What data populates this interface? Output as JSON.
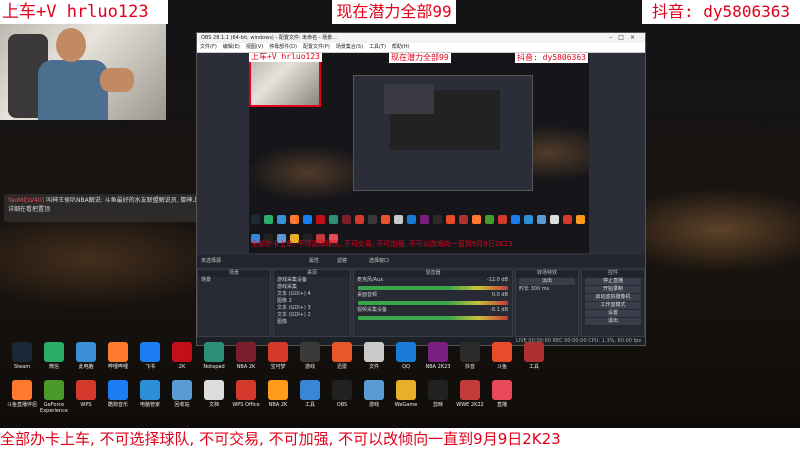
{
  "overlay": {
    "top_left": "上车+V hrluo123",
    "top_center": "现在潜力全部99",
    "top_right": "抖音: dy5806363",
    "bottom": "全部办卡上车, 不可选择球队, 不可交易, 不可加强, 不可以改倾向一直到9月9日2K23"
  },
  "chat": {
    "user": "YaoMi[LV40]",
    "message": "叫神王侯叭NBA解说: 斗鱼最好的水友联盟解说员, 御神上车规则详细在看把置顶"
  },
  "obs": {
    "title": "OBS 28.1.1 (64-bit, windows) - 配置文件: 未命名 - 场景...",
    "menu": [
      "文件(F)",
      "编辑(E)",
      "视图(V)",
      "停靠部件(D)",
      "配置文件(P)",
      "场景集合(S)",
      "工具(T)",
      "帮助(H)"
    ],
    "preview": {
      "banner_left": "上车+V hrluo123",
      "banner_center": "现在潜力全部99",
      "banner_right": "抖音: dy5806363",
      "bottom_text": "全部办卡上车, 不可选择球队, 不可交易, 不可加强, 不可以改倾向一直到9月9日2K23"
    },
    "ctrlbar": {
      "source": "未选择源",
      "properties": "属性",
      "filters": "滤镜",
      "capture": "选择窗口"
    },
    "docks": {
      "scenes": {
        "title": "场景",
        "items": [
          "场景"
        ]
      },
      "sources": {
        "title": "来源",
        "items": [
          "游戏采集设备",
          "游戏采集",
          "文本 (GDI+) 4",
          "图像 2",
          "文本 (GDI+) 3",
          "文本 (GDI+) 2",
          "图像"
        ]
      },
      "mixer": {
        "title": "混音器",
        "channels": [
          {
            "name": "麦克风/Aux",
            "db": "-12.0 dB"
          },
          {
            "name": "桌面音频",
            "db": "0.0 dB"
          },
          {
            "name": "视频采集设备",
            "db": "-8.1 dB"
          }
        ]
      },
      "transitions": {
        "title": "转场特效",
        "type": "淡出",
        "duration_label": "时长",
        "duration": "300 ms"
      },
      "controls": {
        "title": "控件",
        "buttons": [
          "停止直播",
          "开始录制",
          "启动虚拟摄像机",
          "工作室模式",
          "设置",
          "退出"
        ]
      }
    },
    "statusbar": "LIVE 00:00:00  REC 00:00:00  CPU: 1.3%, 60.00 fps"
  },
  "desktop": {
    "row1": [
      {
        "label": "Steam",
        "color": "#1b2838"
      },
      {
        "label": "微信",
        "color": "#2aae67"
      },
      {
        "label": "此电脑",
        "color": "#3a8fd6"
      },
      {
        "label": "哔哩哔哩",
        "color": "#ff7a2f"
      },
      {
        "label": "飞书",
        "color": "#1c7cf2"
      },
      {
        "label": "2K",
        "color": "#c40f1a"
      },
      {
        "label": "Notepad",
        "color": "#2f8f76"
      },
      {
        "label": "NBA 2K",
        "color": "#7a1f2b"
      },
      {
        "label": "宝可梦",
        "color": "#d33a2c"
      },
      {
        "label": "游戏",
        "color": "#3a3a3a"
      },
      {
        "label": "迅雷",
        "color": "#e8562c"
      },
      {
        "label": "文件",
        "color": "#c9c9c9"
      },
      {
        "label": "QQ",
        "color": "#1a7ad8"
      },
      {
        "label": "NBA 2K23",
        "color": "#7a1f7f"
      },
      {
        "label": "抖音",
        "color": "#2b2b2b"
      },
      {
        "label": "斗鱼",
        "color": "#e84a2a"
      },
      {
        "label": "工具",
        "color": "#b03030"
      }
    ],
    "row2": [
      {
        "label": "斗鱼直播伴侣",
        "color": "#ff7a2f"
      },
      {
        "label": "GeForce Experience",
        "color": "#4a9a2a"
      },
      {
        "label": "WPS",
        "color": "#d33a2c"
      },
      {
        "label": "酷狗音乐",
        "color": "#1c7cf2"
      },
      {
        "label": "电脑管家",
        "color": "#2a8fd6"
      },
      {
        "label": "回收站",
        "color": "#5b9bd5"
      },
      {
        "label": "文档",
        "color": "#ddd"
      },
      {
        "label": "WPS Office",
        "color": "#d33a2c"
      },
      {
        "label": "NBA 2K",
        "color": "#ff9a1a"
      },
      {
        "label": "工具",
        "color": "#3a86d6"
      },
      {
        "label": "OBS",
        "color": "#222"
      },
      {
        "label": "游戏",
        "color": "#5b9bd5"
      },
      {
        "label": "WeGame",
        "color": "#e8b02a"
      },
      {
        "label": "剪映",
        "color": "#222"
      },
      {
        "label": "WWE 2K22",
        "color": "#c43a3a"
      },
      {
        "label": "直播",
        "color": "#e84a5a"
      }
    ]
  }
}
